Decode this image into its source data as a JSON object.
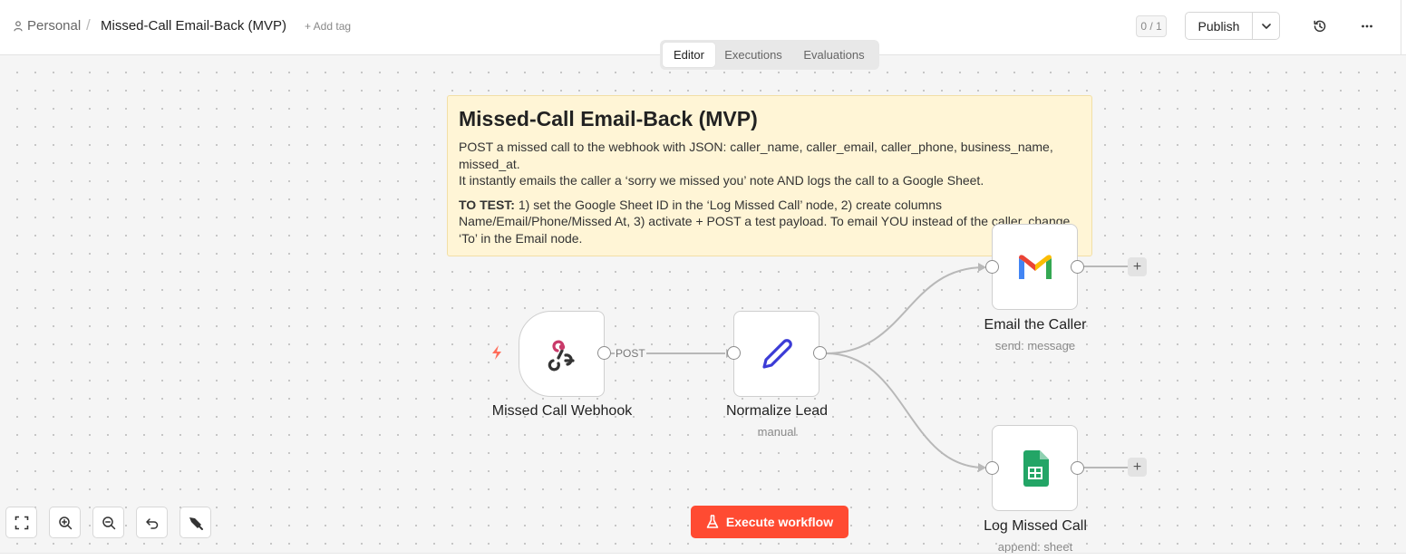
{
  "header": {
    "breadcrumb_personal": "Personal",
    "workflow_title": "Missed-Call Email-Back (MVP)",
    "add_tag": "+ Add tag",
    "counter": "0 / 1",
    "publish_label": "Publish"
  },
  "tabs": [
    "Editor",
    "Executions",
    "Evaluations"
  ],
  "active_tab": "Editor",
  "sticky": {
    "title": "Missed-Call Email-Back (MVP)",
    "line1": "POST a missed call to the webhook with JSON: caller_name, caller_email, caller_phone, business_name, missed_at.",
    "line2": "It instantly emails the caller a ‘sorry we missed you’ note AND logs the call to a Google Sheet.",
    "test_label": "TO TEST:",
    "test_text": " 1) set the Google Sheet ID in the ‘Log Missed Call’ node, 2) create columns Name/Email/Phone/Missed At, 3) activate + POST a test payload. To email YOU instead of the caller, change ‘To’ in the Email node."
  },
  "nodes": {
    "webhook": {
      "name": "Missed Call Webhook",
      "icon": "webhook-icon"
    },
    "normalize": {
      "name": "Normalize Lead",
      "subtitle": "manual",
      "icon": "pencil-icon"
    },
    "email": {
      "name": "Email the Caller",
      "subtitle": "send: message",
      "icon": "gmail-icon"
    },
    "sheet": {
      "name": "Log Missed Call",
      "subtitle": "append: sheet",
      "icon": "google-sheets-icon"
    }
  },
  "edge_label": "POST",
  "plus_glyph": "+",
  "execute_label": "Execute workflow",
  "colors": {
    "accent": "#ff4b32",
    "sticky_bg": "#fff5d6",
    "trigger_bolt": "#ff6d5a"
  }
}
